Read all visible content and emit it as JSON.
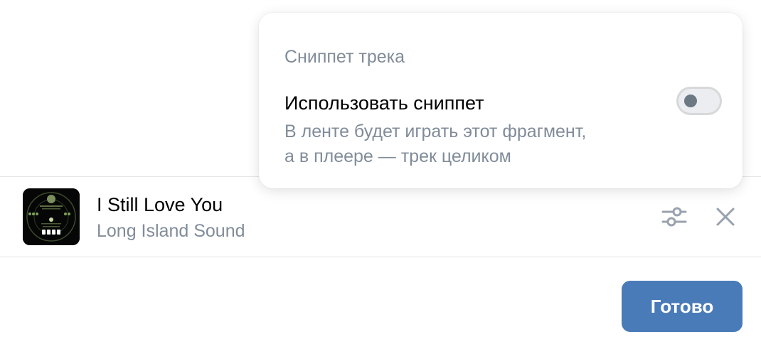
{
  "popover": {
    "header": "Сниппет трека",
    "option_title": "Использовать сниппет",
    "option_description_line1": "В ленте будет играть этот фрагмент,",
    "option_description_line2": "а в плеере — трек целиком",
    "toggle_on": false
  },
  "track": {
    "title": "I Still Love You",
    "artist": "Long Island Sound",
    "cover_icon": "album-cover-image"
  },
  "actions": {
    "settings_icon": "sliders-icon",
    "close_icon": "close-icon",
    "done_label": "Готово"
  },
  "colors": {
    "accent": "#4a7bb9",
    "secondary_text": "#818c99",
    "icon": "#99a2ad",
    "divider": "#e3e5e8"
  }
}
